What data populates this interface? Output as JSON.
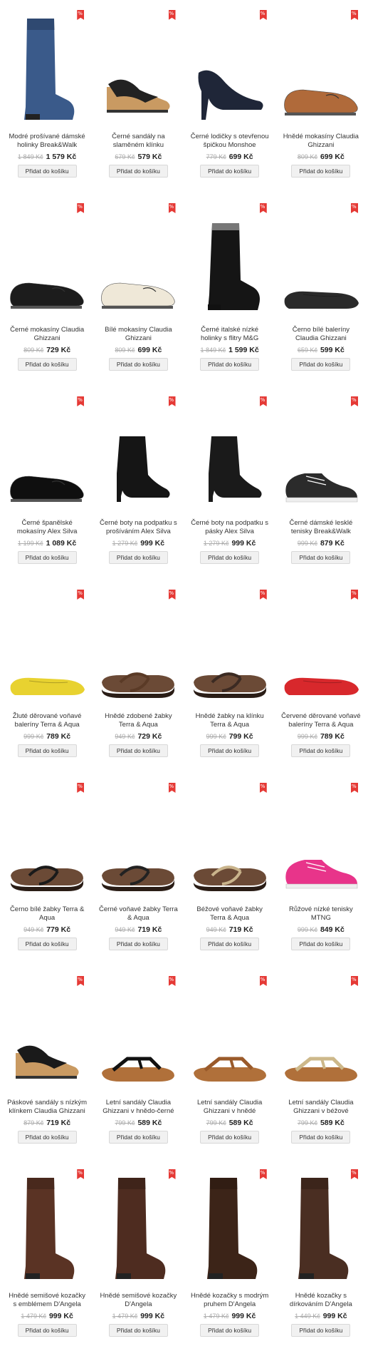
{
  "badge_color": "#e53935",
  "button_label": "Přidat do košíku",
  "products": [
    {
      "name": "Modré prošívané dámské holinky Break&Walk",
      "old_price": "1 849 Kč",
      "new_price": "1 579 Kč",
      "icon": "tall-boot-icon",
      "color": "#3a5a8a"
    },
    {
      "name": "Černé sandály na slaměném klínku",
      "old_price": "679 Kč",
      "new_price": "579 Kč",
      "icon": "wedge-sandal-icon",
      "color": "#222222"
    },
    {
      "name": "Černé lodičky s otevřenou špičkou Monshoe",
      "old_price": "779 Kč",
      "new_price": "699 Kč",
      "icon": "pump-icon",
      "color": "#1f2638"
    },
    {
      "name": "Hnědé mokasíny Claudia Ghizzani",
      "old_price": "809 Kč",
      "new_price": "699 Kč",
      "icon": "loafer-icon",
      "color": "#b06a3a"
    },
    {
      "name": "Černé mokasíny Claudia Ghizzani",
      "old_price": "809 Kč",
      "new_price": "729 Kč",
      "icon": "loafer-icon",
      "color": "#1c1c1c"
    },
    {
      "name": "Bílé mokasíny Claudia Ghizzani",
      "old_price": "809 Kč",
      "new_price": "699 Kč",
      "icon": "loafer-icon",
      "color": "#efe8d8"
    },
    {
      "name": "Černé italské nízké holinky s flitry M&G",
      "old_price": "1 849 Kč",
      "new_price": "1 599 Kč",
      "icon": "ankle-boot-icon",
      "color": "#151515"
    },
    {
      "name": "Černo bílé baleríny Claudia Ghizzani",
      "old_price": "659 Kč",
      "new_price": "599 Kč",
      "icon": "ballerina-icon",
      "color": "#2a2a2a"
    },
    {
      "name": "Černé španělské mokasíny Alex Silva",
      "old_price": "1 199 Kč",
      "new_price": "1 089 Kč",
      "icon": "loafer-icon",
      "color": "#0f0f0f"
    },
    {
      "name": "Černé boty na podpatku s prošíváním Alex Silva",
      "old_price": "1 279 Kč",
      "new_price": "999 Kč",
      "icon": "bootie-icon",
      "color": "#151515"
    },
    {
      "name": "Černé boty na podpatku s pásky Alex Silva",
      "old_price": "1 279 Kč",
      "new_price": "999 Kč",
      "icon": "bootie-icon",
      "color": "#1a1a1a"
    },
    {
      "name": "Černé dámské lesklé tenisky Break&Walk",
      "old_price": "999 Kč",
      "new_price": "879 Kč",
      "icon": "sneaker-icon",
      "color": "#2b2b2b"
    },
    {
      "name": "Žluté děrované voňavé baleríny Terra & Aqua",
      "old_price": "999 Kč",
      "new_price": "789 Kč",
      "icon": "ballerina-icon",
      "color": "#e8d230"
    },
    {
      "name": "Hnědé zdobené žabky Terra & Aqua",
      "old_price": "949 Kč",
      "new_price": "729 Kč",
      "icon": "flip-flop-icon",
      "color": "#5a3a26"
    },
    {
      "name": "Hnědé žabky na klínku Terra & Aqua",
      "old_price": "999 Kč",
      "new_price": "799 Kč",
      "icon": "flip-flop-icon",
      "color": "#3b2a22"
    },
    {
      "name": "Červené děrované voňavé baleríny Terra & Aqua",
      "old_price": "999 Kč",
      "new_price": "789 Kč",
      "icon": "ballerina-icon",
      "color": "#d8282c"
    },
    {
      "name": "Černo bílé žabky Terra & Aqua",
      "old_price": "949 Kč",
      "new_price": "779 Kč",
      "icon": "flip-flop-icon",
      "color": "#1a1a1a"
    },
    {
      "name": "Černé voňavé žabky Terra & Aqua",
      "old_price": "949 Kč",
      "new_price": "719 Kč",
      "icon": "flip-flop-icon",
      "color": "#222222"
    },
    {
      "name": "Béžové voňavé žabky Terra & Aqua",
      "old_price": "949 Kč",
      "new_price": "719 Kč",
      "icon": "flip-flop-icon",
      "color": "#c9b48c"
    },
    {
      "name": "Růžové nízké tenisky MTNG",
      "old_price": "999 Kč",
      "new_price": "849 Kč",
      "icon": "sneaker-icon",
      "color": "#e8348a"
    },
    {
      "name": "Páskové sandály s nízkým klínkem Claudia Ghizzani",
      "old_price": "879 Kč",
      "new_price": "719 Kč",
      "icon": "wedge-sandal-icon",
      "color": "#1a1a1a"
    },
    {
      "name": "Letní sandály Claudia Ghizzani v hnědo-černé",
      "old_price": "799 Kč",
      "new_price": "589 Kč",
      "icon": "t-strap-sandal-icon",
      "color": "#111111"
    },
    {
      "name": "Letní sandály Claudia Ghizzani v hnědé",
      "old_price": "799 Kč",
      "new_price": "589 Kč",
      "icon": "t-strap-sandal-icon",
      "color": "#9a5a2a"
    },
    {
      "name": "Letní sandály Claudia Ghizzani v béžové",
      "old_price": "799 Kč",
      "new_price": "589 Kč",
      "icon": "t-strap-sandal-icon",
      "color": "#cdb88a"
    },
    {
      "name": "Hnědé semišové kozačky s emblémem D'Angela",
      "old_price": "1 479 Kč",
      "new_price": "999 Kč",
      "icon": "tall-boot-icon",
      "color": "#5a3324"
    },
    {
      "name": "Hnědé semišové kozačky D'Angela",
      "old_price": "1 479 Kč",
      "new_price": "999 Kč",
      "icon": "tall-boot-icon",
      "color": "#4e2c20"
    },
    {
      "name": "Hnědé kozačky s modrým pruhem D'Angela",
      "old_price": "1 479 Kč",
      "new_price": "999 Kč",
      "icon": "tall-boot-icon",
      "color": "#3c2418"
    },
    {
      "name": "Hnědé kozačky s dírkováním D'Angela",
      "old_price": "1 449 Kč",
      "new_price": "999 Kč",
      "icon": "tall-boot-icon",
      "color": "#4a2e22"
    }
  ]
}
